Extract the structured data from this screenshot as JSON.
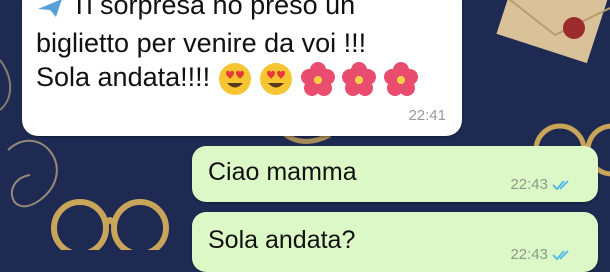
{
  "chat": {
    "incoming": {
      "line1": "Ti sorpresa ho preso un",
      "line2": "biglietto per venire da voi !!!",
      "line3": "Sola andata!!!!",
      "time": "22:41"
    },
    "outgoing": [
      {
        "text": "Ciao mamma",
        "time": "22:43",
        "status_icon": "double-check-read"
      },
      {
        "text": "Sola andata?",
        "time": "22:43",
        "status_icon": "double-check-read"
      }
    ]
  },
  "colors": {
    "wallpaper": "#1e2a52",
    "incoming_bubble": "#ffffff",
    "outgoing_bubble": "#dcf8c6",
    "read_ticks": "#4fb6ec"
  }
}
